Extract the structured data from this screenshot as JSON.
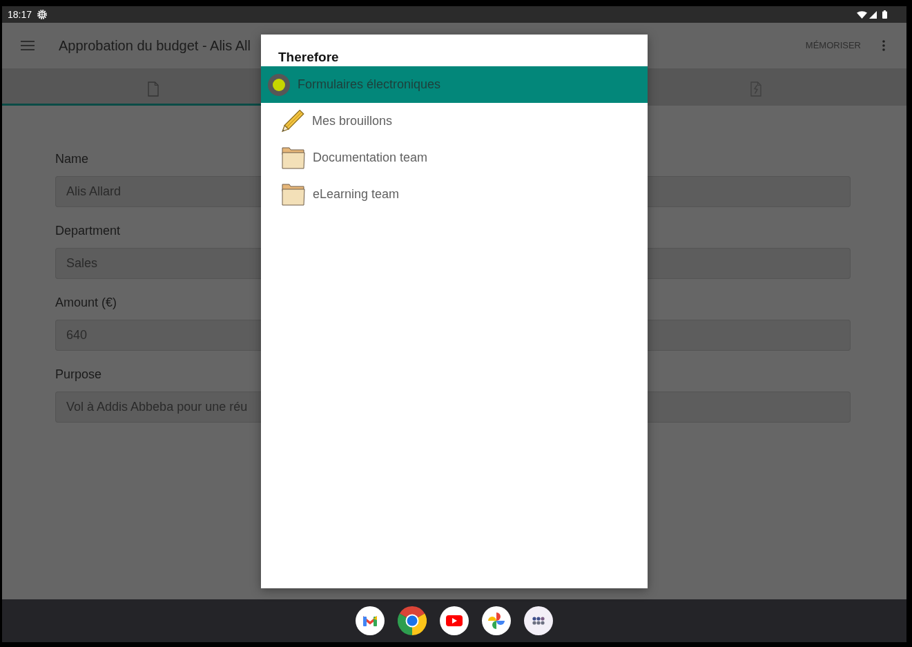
{
  "status_bar": {
    "time": "18:17"
  },
  "app_bar": {
    "title": "Approbation du budget - Alis All",
    "action": "MÉMORISER"
  },
  "tabs": [
    {
      "kind": "form",
      "selected": true
    },
    {
      "kind": "attachment",
      "selected": false
    }
  ],
  "form": {
    "fields": [
      {
        "label": "Name",
        "value": "Alis Allard"
      },
      {
        "label": "Department",
        "value": "Sales"
      },
      {
        "label": "Amount (€)",
        "value": "640"
      },
      {
        "label": "Purpose",
        "value": "Vol à Addis Abbeba pour une réu"
      }
    ]
  },
  "dialog": {
    "title": "Therefore",
    "items": [
      {
        "kind": "root",
        "label": "Formulaires électroniques",
        "selected": true,
        "children": [
          {
            "kind": "drafts",
            "label": "Mes brouillons",
            "selected": false
          },
          {
            "kind": "folder",
            "label": "Documentation team",
            "selected": false
          },
          {
            "kind": "folder",
            "label": "eLearning team",
            "selected": false
          }
        ]
      }
    ]
  }
}
